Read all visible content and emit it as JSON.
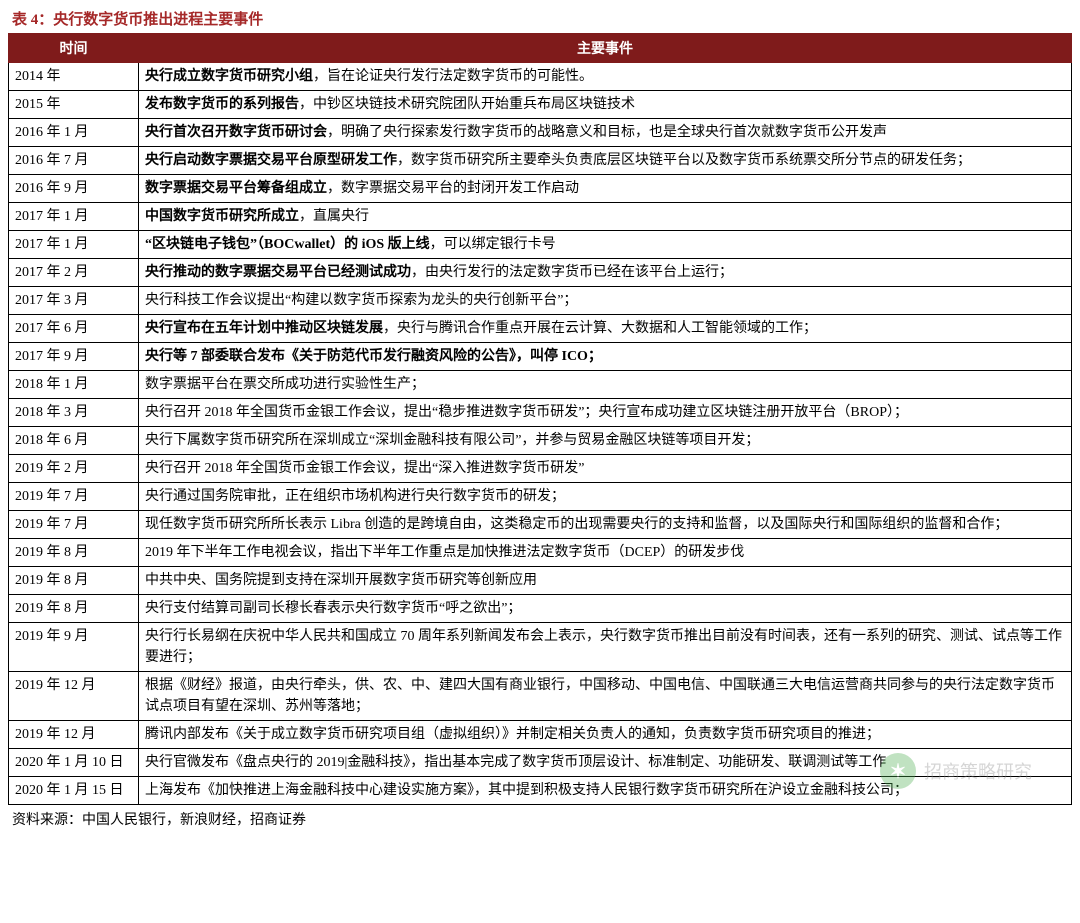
{
  "title": "表 4：央行数字货币推出进程主要事件",
  "headers": {
    "time": "时间",
    "event": "主要事件"
  },
  "rows": [
    {
      "time": "2014 年",
      "strong": "央行成立数字货币研究小组",
      "rest": "，旨在论证央行发行法定数字货币的可能性。"
    },
    {
      "time": "2015 年",
      "strong": "发布数字货币的系列报告",
      "rest": "，中钞区块链技术研究院团队开始重兵布局区块链技术"
    },
    {
      "time": "2016 年 1 月",
      "strong": "央行首次召开数字货币研讨会",
      "rest": "，明确了央行探索发行数字货币的战略意义和目标，也是全球央行首次就数字货币公开发声"
    },
    {
      "time": "2016 年 7 月",
      "strong": "央行启动数字票据交易平台原型研发工作",
      "rest": "，数字货币研究所主要牵头负责底层区块链平台以及数字货币系统票交所分节点的研发任务；"
    },
    {
      "time": "2016 年 9 月",
      "strong": "数字票据交易平台筹备组成立",
      "rest": "，数字票据交易平台的封闭开发工作启动"
    },
    {
      "time": "2017 年 1 月",
      "strong": "中国数字货币研究所成立",
      "rest": "，直属央行"
    },
    {
      "time": "2017 年 1 月",
      "strong": "“区块链电子钱包”（BOCwallet）的 iOS 版上线",
      "rest": "，可以绑定银行卡号"
    },
    {
      "time": "2017 年 2 月",
      "strong": "央行推动的数字票据交易平台已经测试成功",
      "rest": "，由央行发行的法定数字货币已经在该平台上运行；"
    },
    {
      "time": "2017 年 3 月",
      "strong": "",
      "rest": "央行科技工作会议提出“构建以数字货币探索为龙头的央行创新平台”；"
    },
    {
      "time": "2017 年 6 月",
      "strong": "央行宣布在五年计划中推动区块链发展",
      "rest": "，央行与腾讯合作重点开展在云计算、大数据和人工智能领域的工作；"
    },
    {
      "time": "2017 年 9 月",
      "strong": "央行等 7 部委联合发布《关于防范代币发行融资风险的公告》，叫停 ICO；",
      "rest": ""
    },
    {
      "time": "2018 年 1 月",
      "strong": "",
      "rest": "数字票据平台在票交所成功进行实验性生产；"
    },
    {
      "time": "2018 年 3 月",
      "strong": "",
      "rest": "央行召开 2018 年全国货币金银工作会议，提出“稳步推进数字货币研发”；央行宣布成功建立区块链注册开放平台（BROP）；"
    },
    {
      "time": "2018 年 6 月",
      "strong": "",
      "rest": "央行下属数字货币研究所在深圳成立“深圳金融科技有限公司”，并参与贸易金融区块链等项目开发；"
    },
    {
      "time": "2019 年 2 月",
      "strong": "",
      "rest": "央行召开 2018 年全国货币金银工作会议，提出“深入推进数字货币研发”"
    },
    {
      "time": "2019 年 7 月",
      "strong": "",
      "rest": "央行通过国务院审批，正在组织市场机构进行央行数字货币的研发；"
    },
    {
      "time": "2019 年 7 月",
      "strong": "",
      "rest": "现任数字货币研究所所长表示 Libra 创造的是跨境自由，这类稳定币的出现需要央行的支持和监督，以及国际央行和国际组织的监督和合作；"
    },
    {
      "time": "2019 年 8 月",
      "strong": "",
      "rest": "2019 年下半年工作电视会议，指出下半年工作重点是加快推进法定数字货币（DCEP）的研发步伐"
    },
    {
      "time": "2019 年 8 月",
      "strong": "",
      "rest": "中共中央、国务院提到支持在深圳开展数字货币研究等创新应用"
    },
    {
      "time": "2019 年 8 月",
      "strong": "",
      "rest": "央行支付结算司副司长穆长春表示央行数字货币“呼之欲出”；"
    },
    {
      "time": "2019 年 9 月",
      "strong": "",
      "rest": "央行行长易纲在庆祝中华人民共和国成立 70 周年系列新闻发布会上表示，央行数字货币推出目前没有时间表，还有一系列的研究、测试、试点等工作要进行；"
    },
    {
      "time": "2019 年 12 月",
      "strong": "",
      "rest": "根据《财经》报道，由央行牵头，供、农、中、建四大国有商业银行，中国移动、中国电信、中国联通三大电信运营商共同参与的央行法定数字货币试点项目有望在深圳、苏州等落地；"
    },
    {
      "time": "2019 年 12 月",
      "strong": "",
      "rest": "腾讯内部发布《关于成立数字货币研究项目组（虚拟组织）》并制定相关负责人的通知，负责数字货币研究项目的推进；"
    },
    {
      "time": "2020 年 1 月 10 日",
      "strong": "",
      "rest": "央行官微发布《盘点央行的 2019|金融科技》，指出基本完成了数字货币顶层设计、标准制定、功能研发、联调测试等工作"
    },
    {
      "time": "2020 年 1 月 15 日",
      "strong": "",
      "rest": "上海发布《加快推进上海金融科技中心建设实施方案》，其中提到积极支持人民银行数字货币研究所在沪设立金融科技公司；"
    }
  ],
  "source": "资料来源：中国人民银行，新浪财经，招商证券",
  "watermark": "招商策略研究"
}
